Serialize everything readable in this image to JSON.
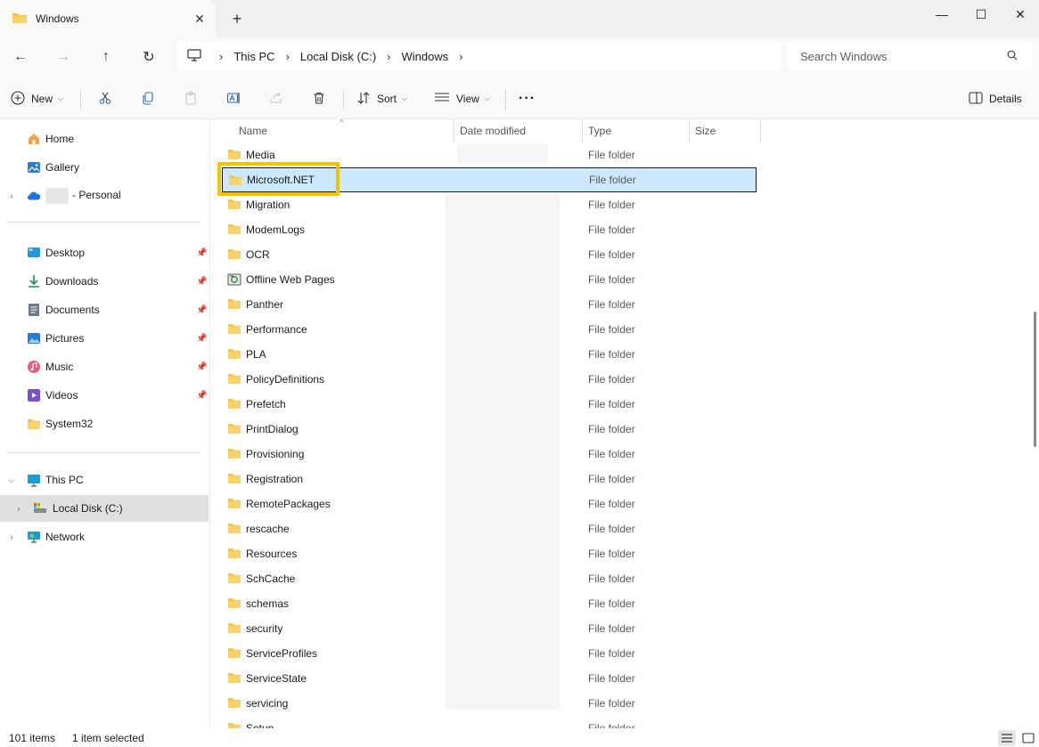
{
  "window": {
    "tab_title": "Windows",
    "new_tab": "+",
    "minimize": "—",
    "maximize": "☐",
    "close": "✕"
  },
  "nav": {
    "back": "←",
    "forward": "→",
    "up": "↑",
    "refresh": "↻"
  },
  "breadcrumb": [
    "This PC",
    "Local Disk (C:)",
    "Windows"
  ],
  "search": {
    "placeholder": "Search Windows"
  },
  "commands": {
    "new": "New",
    "sort": "Sort",
    "view": "View",
    "more": "···",
    "details": "Details"
  },
  "sidebar": {
    "home": "Home",
    "gallery": "Gallery",
    "onedrive": "- Personal",
    "desktop": "Desktop",
    "downloads": "Downloads",
    "documents": "Documents",
    "pictures": "Pictures",
    "music": "Music",
    "videos": "Videos",
    "system32": "System32",
    "this_pc": "This PC",
    "local_disk": "Local Disk (C:)",
    "network": "Network"
  },
  "columns": {
    "name": "Name",
    "date_modified": "Date modified",
    "type": "Type",
    "size": "Size"
  },
  "files": [
    {
      "name": "Media",
      "type": "File folder"
    },
    {
      "name": "Microsoft.NET",
      "type": "File folder",
      "selected": true
    },
    {
      "name": "Migration",
      "type": "File folder"
    },
    {
      "name": "ModemLogs",
      "type": "File folder"
    },
    {
      "name": "OCR",
      "type": "File folder"
    },
    {
      "name": "Offline Web Pages",
      "type": "File folder",
      "special_icon": "offline-pages-icon"
    },
    {
      "name": "Panther",
      "type": "File folder"
    },
    {
      "name": "Performance",
      "type": "File folder"
    },
    {
      "name": "PLA",
      "type": "File folder"
    },
    {
      "name": "PolicyDefinitions",
      "type": "File folder"
    },
    {
      "name": "Prefetch",
      "type": "File folder"
    },
    {
      "name": "PrintDialog",
      "type": "File folder"
    },
    {
      "name": "Provisioning",
      "type": "File folder"
    },
    {
      "name": "Registration",
      "type": "File folder"
    },
    {
      "name": "RemotePackages",
      "type": "File folder"
    },
    {
      "name": "rescache",
      "type": "File folder"
    },
    {
      "name": "Resources",
      "type": "File folder"
    },
    {
      "name": "SchCache",
      "type": "File folder"
    },
    {
      "name": "schemas",
      "type": "File folder"
    },
    {
      "name": "security",
      "type": "File folder"
    },
    {
      "name": "ServiceProfiles",
      "type": "File folder"
    },
    {
      "name": "ServiceState",
      "type": "File folder"
    },
    {
      "name": "servicing",
      "type": "File folder"
    },
    {
      "name": "Setup",
      "type": "File folder"
    }
  ],
  "status": {
    "item_count": "101 items",
    "selection": "1 item selected"
  },
  "colors": {
    "folder": "#f4c44d",
    "selection_bg": "#cce8ff",
    "highlight_box": "#f5c200"
  }
}
